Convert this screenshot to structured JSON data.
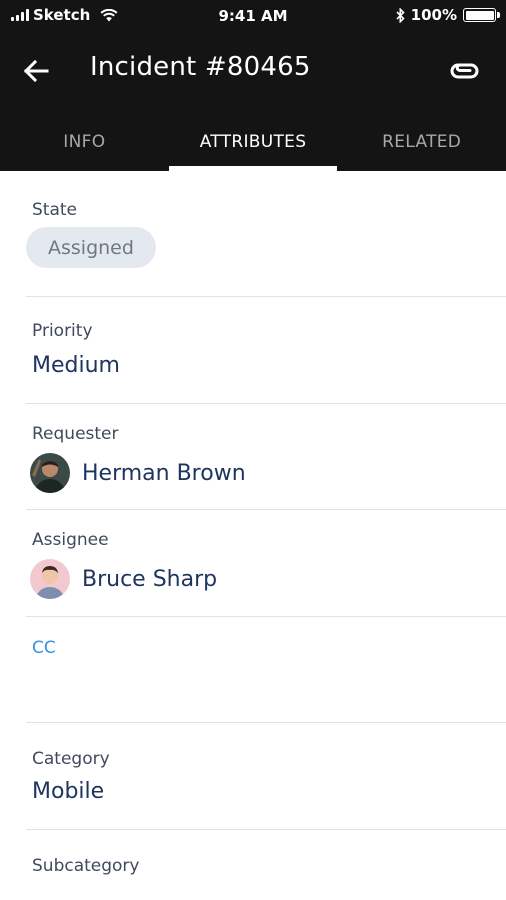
{
  "status_bar": {
    "carrier": "Sketch",
    "time": "9:41 AM",
    "battery": "100%"
  },
  "nav": {
    "title": "Incident #80465",
    "back_icon": "arrow-left-icon",
    "attach_icon": "paperclip-link-icon"
  },
  "tabs": [
    {
      "label": "INFO",
      "active": false
    },
    {
      "label": "ATTRIBUTES",
      "active": true
    },
    {
      "label": "RELATED",
      "active": false
    }
  ],
  "fields": {
    "state": {
      "label": "State",
      "value": "Assigned"
    },
    "priority": {
      "label": "Priority",
      "value": "Medium"
    },
    "requester": {
      "label": "Requester",
      "name": "Herman Brown"
    },
    "assignee": {
      "label": "Assignee",
      "name": "Bruce Sharp"
    },
    "cc": {
      "label": "CC"
    },
    "category": {
      "label": "Category",
      "value": "Mobile"
    },
    "subcategory": {
      "label": "Subcategory"
    }
  },
  "colors": {
    "header_bg": "#141414",
    "value_text": "#1f3560",
    "cc_link": "#3b8fe0",
    "pill_bg": "#e3e9ee"
  }
}
